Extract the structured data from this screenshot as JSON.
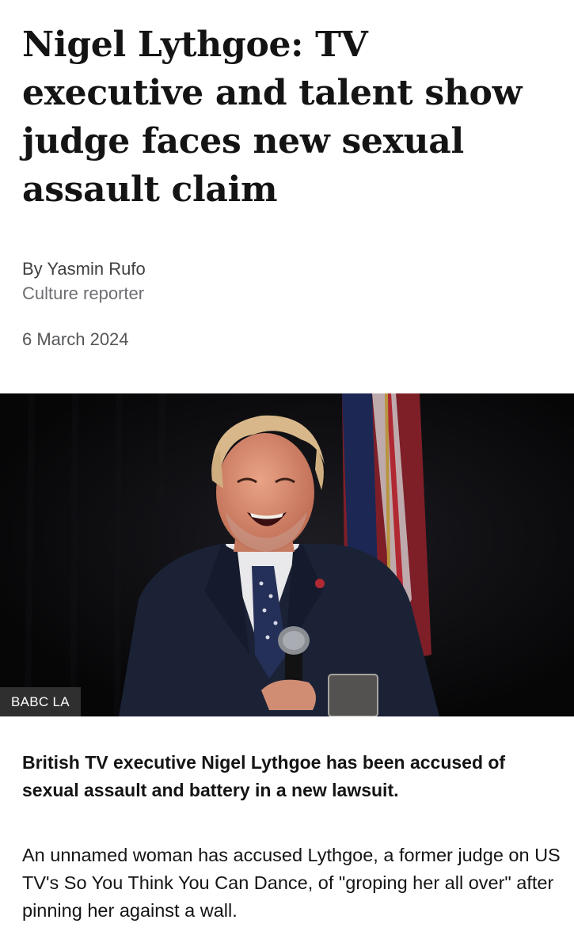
{
  "article": {
    "headline": "Nigel Lythgoe: TV executive and talent show judge faces new sexual assault claim",
    "byline": {
      "author": "By Yasmin Rufo",
      "role": "Culture reporter"
    },
    "date": "6 March 2024",
    "image": {
      "credit": "BABC LA"
    },
    "intro": "British TV executive Nigel Lythgoe has been accused of sexual assault and battery in a new lawsuit.",
    "paragraphs": [
      "An unnamed woman has accused Lythgoe, a former judge on US TV's So You Think You Can Dance, of \"groping her all over\" after pinning her against a wall."
    ]
  }
}
